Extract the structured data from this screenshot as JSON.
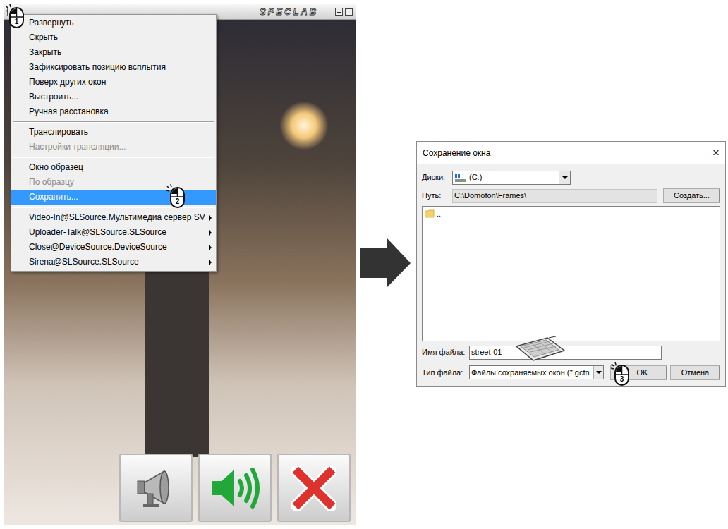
{
  "camera_window": {
    "logo": "SPECLAB"
  },
  "context_menu": {
    "groups": [
      [
        {
          "label": "Развернуть",
          "disabled": false,
          "selected": false,
          "submenu": false
        },
        {
          "label": "Скрыть",
          "disabled": false,
          "selected": false,
          "submenu": false
        },
        {
          "label": "Закрыть",
          "disabled": false,
          "selected": false,
          "submenu": false
        },
        {
          "label": "Зафиксировать позицию всплытия",
          "disabled": false,
          "selected": false,
          "submenu": false
        },
        {
          "label": "Поверх других окон",
          "disabled": false,
          "selected": false,
          "submenu": false
        },
        {
          "label": "Выстроить...",
          "disabled": false,
          "selected": false,
          "submenu": false
        },
        {
          "label": "Ручная расстановка",
          "disabled": false,
          "selected": false,
          "submenu": false
        }
      ],
      [
        {
          "label": "Транслировать",
          "disabled": false,
          "selected": false,
          "submenu": false
        },
        {
          "label": "Настройки трансляции...",
          "disabled": true,
          "selected": false,
          "submenu": false
        }
      ],
      [
        {
          "label": "Окно образец",
          "disabled": false,
          "selected": false,
          "submenu": false
        },
        {
          "label": "По образцу",
          "disabled": true,
          "selected": false,
          "submenu": false
        },
        {
          "label": "Сохранить...",
          "disabled": false,
          "selected": true,
          "submenu": false
        }
      ],
      [
        {
          "label": "Video-In@SLSource.Мультимедиа сервер SV",
          "disabled": false,
          "selected": false,
          "submenu": true
        },
        {
          "label": "Uploader-Talk@SLSource.SLSource",
          "disabled": false,
          "selected": false,
          "submenu": true
        },
        {
          "label": "Close@DeviceSource.DeviceSource",
          "disabled": false,
          "selected": false,
          "submenu": true
        },
        {
          "label": "Sirena@SLSource.SLSource",
          "disabled": false,
          "selected": false,
          "submenu": true
        }
      ]
    ]
  },
  "dialog": {
    "title": "Сохранение окна",
    "close": "×",
    "drive_label": "Диски:",
    "drive": "(C:)",
    "path_label": "Путь:",
    "path": "C:\\Domofon\\Frames\\",
    "create_button": "Создать...",
    "files": [
      ".."
    ],
    "file_name_label": "Имя файла:",
    "file_name": "street-01",
    "file_type_label": "Тип файла:",
    "file_type": "Файлы сохраняемых окон (*.gcfn",
    "ok": "OK",
    "cancel": "Отмена"
  },
  "annotations": {
    "steps": [
      "1",
      "2",
      "3"
    ]
  }
}
